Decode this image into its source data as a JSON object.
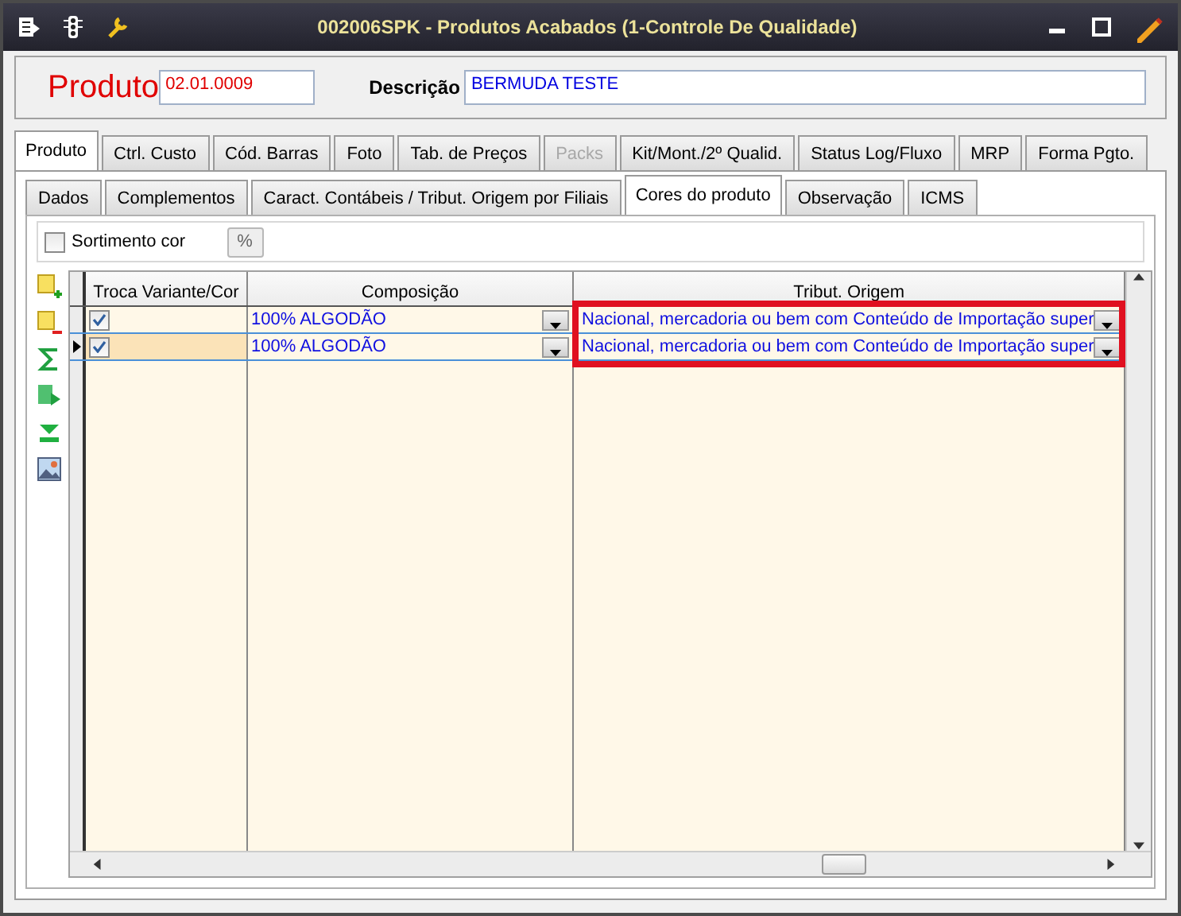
{
  "window": {
    "title": "002006SPK - Produtos Acabados (1-Controle De Qualidade)"
  },
  "header": {
    "produto_label": "Produto",
    "produto_value": "02.01.0009",
    "descricao_label": "Descrição",
    "descricao_value": "BERMUDA TESTE"
  },
  "tabs": [
    {
      "label": "Produto",
      "selected": true,
      "disabled": false
    },
    {
      "label": "Ctrl. Custo",
      "selected": false,
      "disabled": false
    },
    {
      "label": "Cód. Barras",
      "selected": false,
      "disabled": false
    },
    {
      "label": "Foto",
      "selected": false,
      "disabled": false
    },
    {
      "label": "Tab. de Preços",
      "selected": false,
      "disabled": false
    },
    {
      "label": "Packs",
      "selected": false,
      "disabled": true
    },
    {
      "label": "Kit/Mont./2º Qualid.",
      "selected": false,
      "disabled": false
    },
    {
      "label": "Status Log/Fluxo",
      "selected": false,
      "disabled": false
    },
    {
      "label": "MRP",
      "selected": false,
      "disabled": false
    },
    {
      "label": "Forma Pgto.",
      "selected": false,
      "disabled": false
    }
  ],
  "subtabs": [
    {
      "label": "Dados",
      "selected": false
    },
    {
      "label": "Complementos",
      "selected": false
    },
    {
      "label": "Caract. Contábeis / Tribut. Origem por Filiais",
      "selected": false
    },
    {
      "label": "Cores do produto",
      "selected": true
    },
    {
      "label": "Observação",
      "selected": false
    },
    {
      "label": "ICMS",
      "selected": false
    }
  ],
  "options": {
    "sortimento_label": "Sortimento cor",
    "sortimento_checked": false,
    "percent_button": "%"
  },
  "grid": {
    "columns": [
      {
        "label": "Troca Variante/Cor",
        "highlighted": false
      },
      {
        "label": "Composição",
        "highlighted": false
      },
      {
        "label": "Tribut. Origem",
        "highlighted": true
      }
    ],
    "rows": [
      {
        "selected": false,
        "checked": true,
        "composicao": "100% ALGODÃO",
        "tribut": "Nacional, mercadoria ou bem com Conteúdo de Importação super"
      },
      {
        "selected": true,
        "checked": true,
        "composicao": "100% ALGODÃO",
        "tribut": "Nacional, mercadoria ou bem com Conteúdo de Importação super"
      }
    ]
  }
}
